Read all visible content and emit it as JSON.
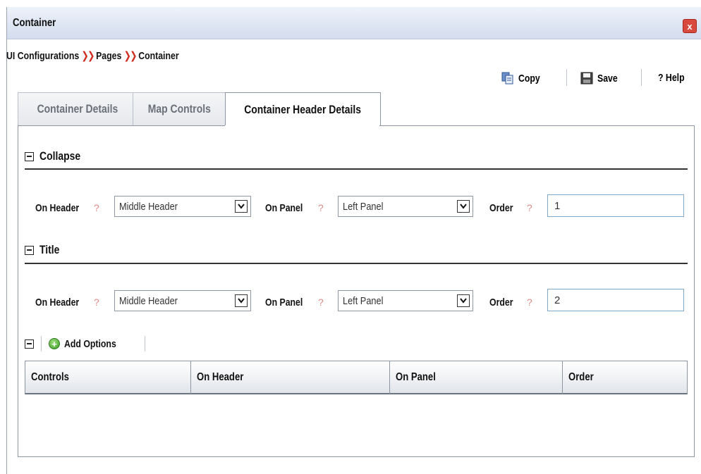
{
  "window": {
    "title": "Container",
    "close_label": "x"
  },
  "breadcrumb": {
    "items": [
      "UI Configurations",
      "Pages",
      "Container"
    ],
    "separator": "»"
  },
  "toolbar": {
    "copy_label": "Copy",
    "save_label": "Save",
    "help_label": "? Help"
  },
  "tabs": [
    {
      "label": "Container Details",
      "active": false
    },
    {
      "label": "Map Controls",
      "active": false
    },
    {
      "label": "Container Header Details",
      "active": true
    }
  ],
  "sections": {
    "collapse": {
      "title": "Collapse",
      "on_header_label": "On Header",
      "on_header_value": "Middle Header",
      "on_panel_label": "On Panel",
      "on_panel_value": "Left Panel",
      "order_label": "Order",
      "order_value": "1"
    },
    "title": {
      "title": "Title",
      "on_header_label": "On Header",
      "on_header_value": "Middle Header",
      "on_panel_label": "On Panel",
      "on_panel_value": "Left Panel",
      "order_label": "Order",
      "order_value": "2"
    }
  },
  "help_glyph": "?",
  "options": {
    "add_label": "Add Options",
    "columns": [
      "Controls",
      "On Header",
      "On Panel",
      "Order"
    ]
  },
  "colors": {
    "separator_red": "#d22b1f",
    "help_pink": "#e08b8b",
    "add_green": "#3f9a2a",
    "close_red": "#d84a3e"
  }
}
